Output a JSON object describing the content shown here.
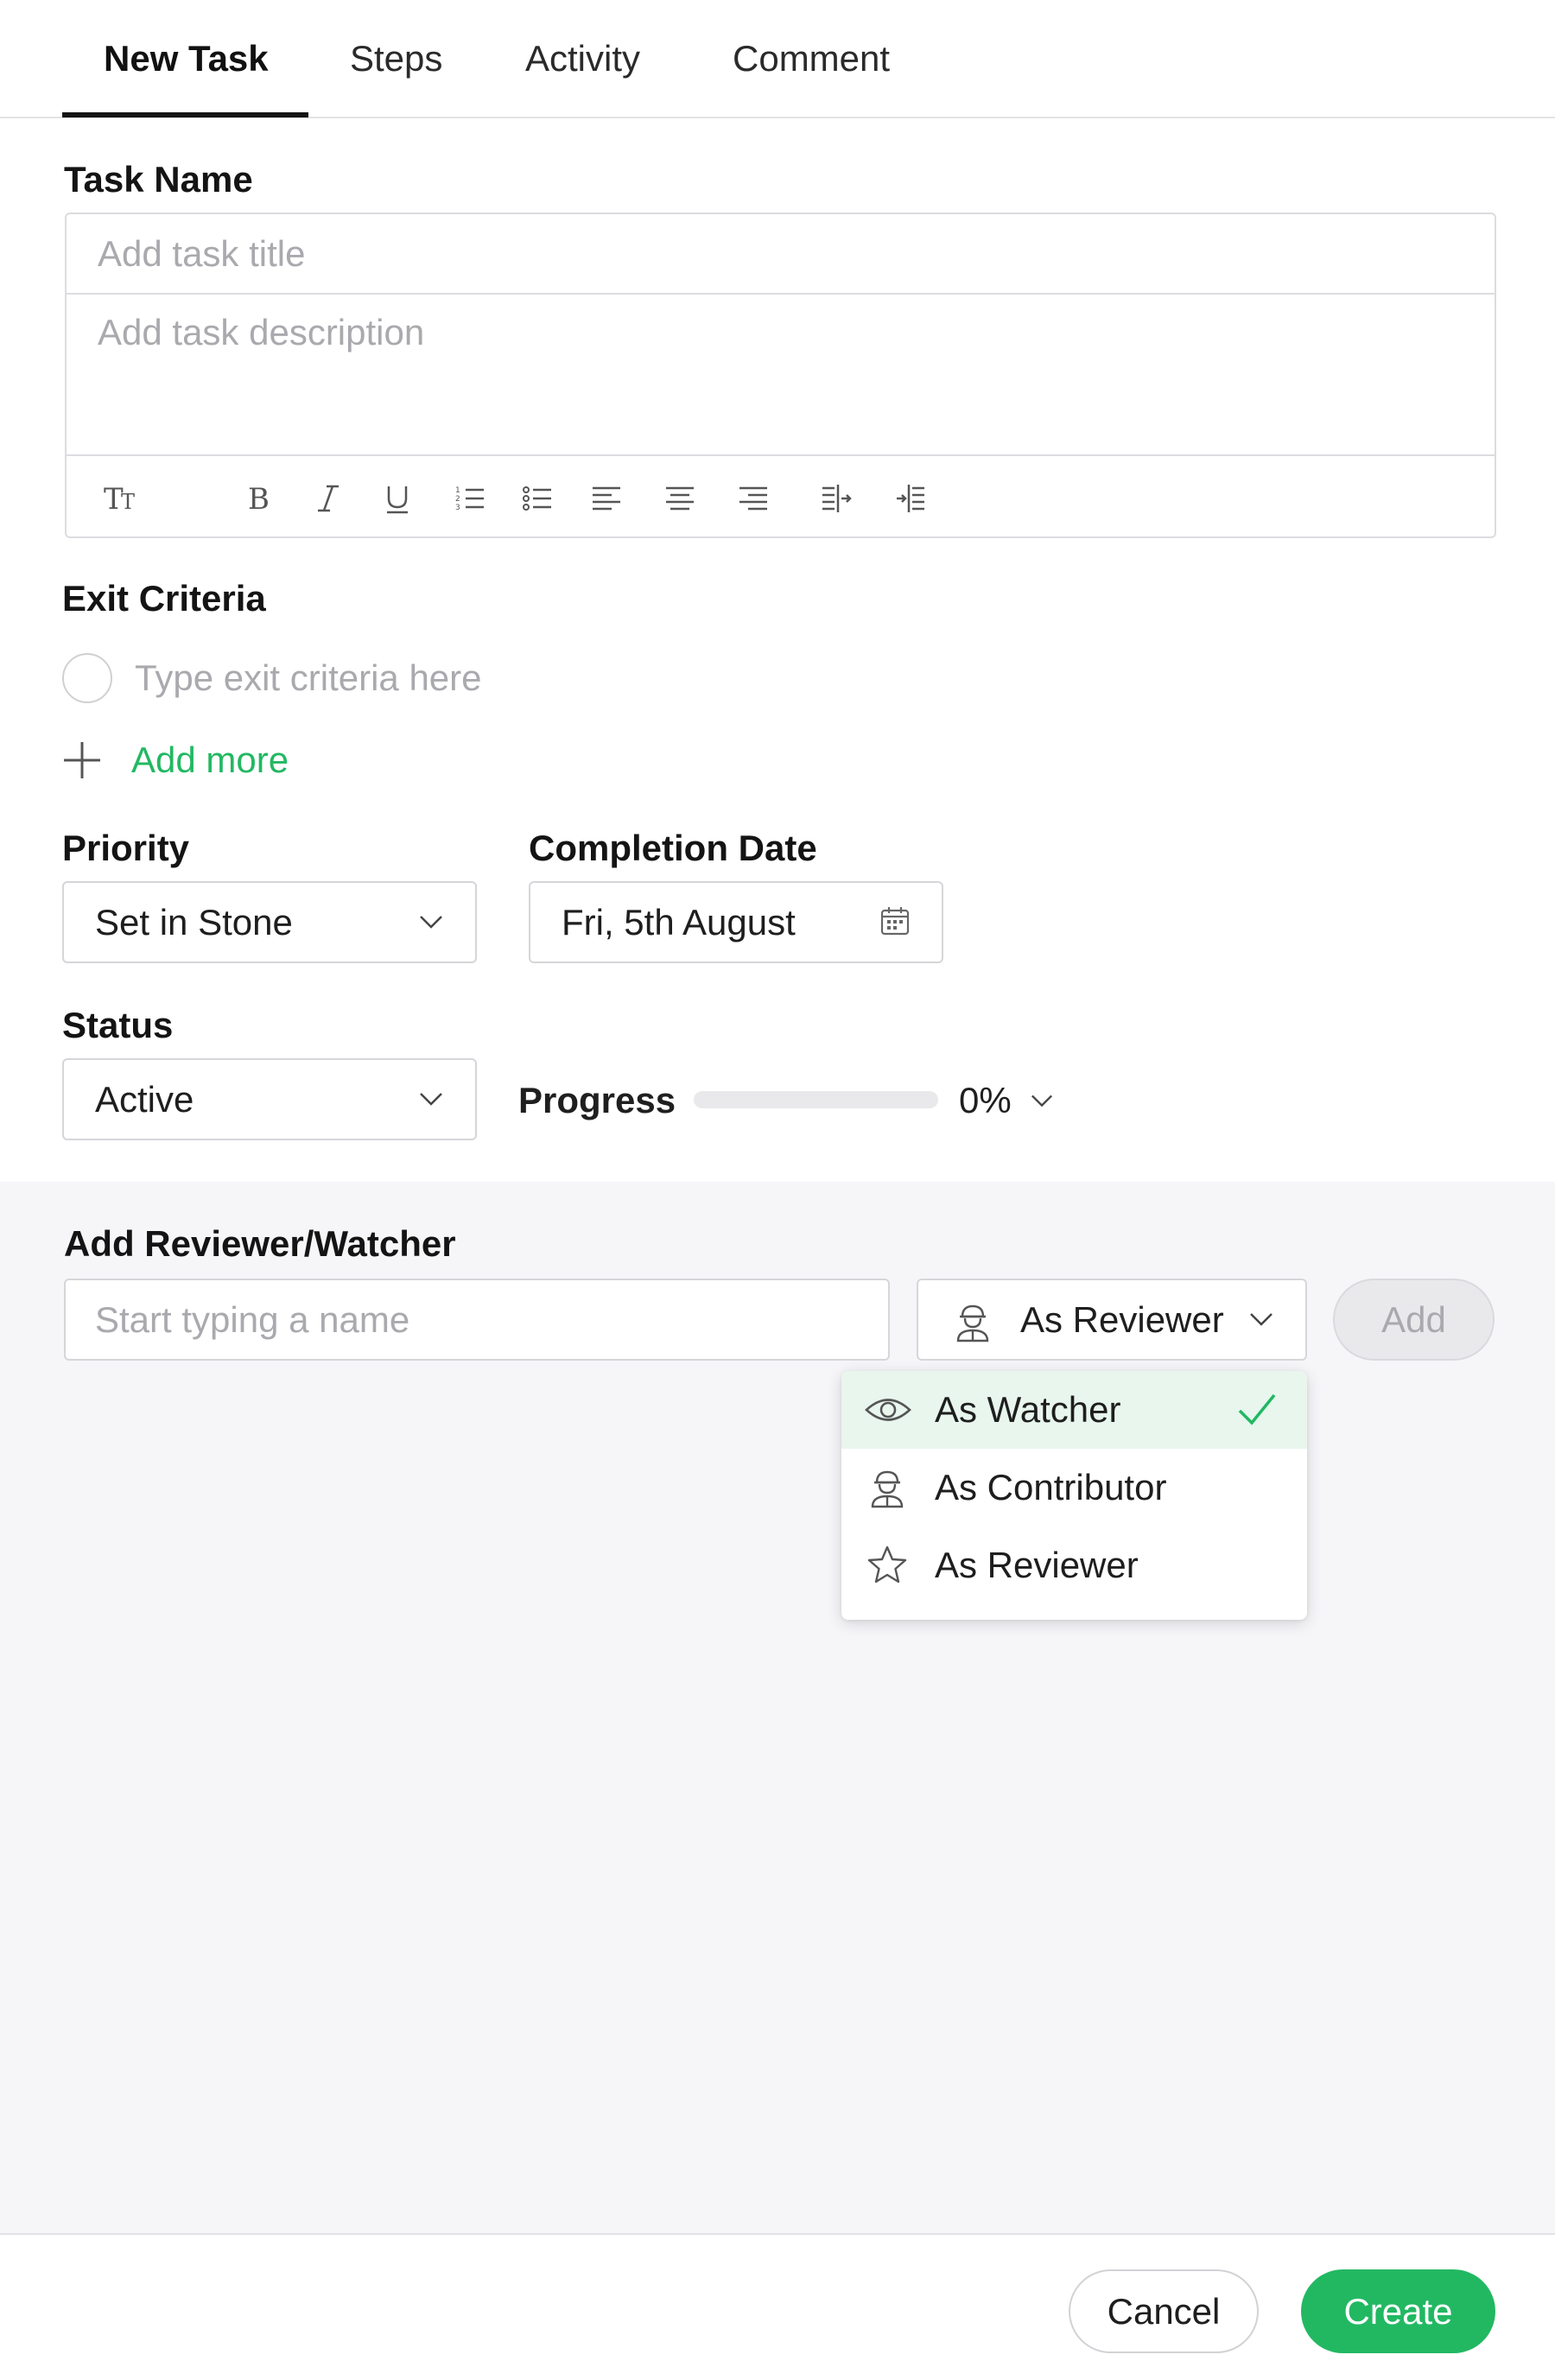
{
  "tabs": [
    {
      "label": "New Task",
      "active": true
    },
    {
      "label": "Steps"
    },
    {
      "label": "Activity"
    },
    {
      "label": "Comment"
    }
  ],
  "task": {
    "label": "Task Name",
    "title_placeholder": "Add task title",
    "description_placeholder": "Add task description",
    "toolbar": [
      "text-size-icon",
      "bold-icon",
      "italic-icon",
      "underline-icon",
      "ordered-list-icon",
      "bullet-list-icon",
      "align-left-icon",
      "align-center-icon",
      "align-right-icon",
      "indent-icon",
      "outdent-icon"
    ]
  },
  "exit_criteria": {
    "label": "Exit Criteria",
    "placeholder": "Type exit criteria here",
    "add_more": "Add more"
  },
  "priority": {
    "label": "Priority",
    "value": "Set in Stone"
  },
  "completion_date": {
    "label": "Completion Date",
    "value": "Fri, 5th August"
  },
  "status": {
    "label": "Status",
    "value": "Active"
  },
  "progress": {
    "label": "Progress",
    "value": "0%",
    "fraction": 0
  },
  "reviewer": {
    "label": "Add Reviewer/Watcher",
    "placeholder": "Start typing a name",
    "role_value": "As Reviewer",
    "add_label": "Add",
    "options": [
      {
        "label": "As Watcher",
        "icon": "eye-icon",
        "selected": true
      },
      {
        "label": "As Contributor",
        "icon": "contributor-icon"
      },
      {
        "label": "As Reviewer",
        "icon": "star-icon"
      }
    ]
  },
  "footer": {
    "cancel": "Cancel",
    "create": "Create"
  },
  "colors": {
    "accent": "#22b862",
    "selected_bg": "#e8f6ee",
    "lower_bg": "#f6f6f9"
  }
}
